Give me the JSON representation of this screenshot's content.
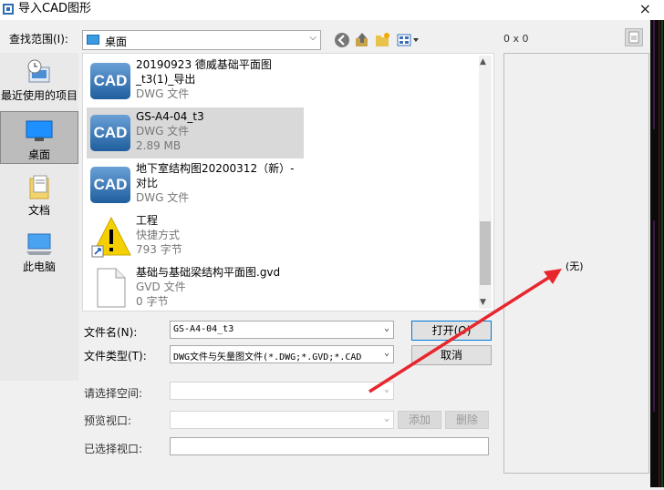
{
  "window": {
    "title": "导入CAD图形",
    "close_glyph": "×"
  },
  "lookin": {
    "label": "查找范围(I):",
    "value": "桌面"
  },
  "toolbar": {
    "back": "back-icon",
    "up": "up-folder-icon",
    "newfolder": "new-folder-icon",
    "views": "views-menu-icon"
  },
  "places": [
    {
      "label": "最近使用的项目",
      "icon": "recent-icon"
    },
    {
      "label": "桌面",
      "icon": "desktop-icon",
      "selected": true
    },
    {
      "label": "文档",
      "icon": "documents-icon"
    },
    {
      "label": "此电脑",
      "icon": "computer-icon"
    }
  ],
  "files": [
    {
      "name1": "20190923 德威基础平面图",
      "name2": "_t3(1)_导出",
      "type": "DWG 文件",
      "icon": "cad-file-icon"
    },
    {
      "name1": "GS-A4-04_t3",
      "type": "DWG 文件",
      "size": "2.89 MB",
      "icon": "cad-file-icon",
      "selected": true
    },
    {
      "name1": "地下室结构图20200312（新）-",
      "name2": "对比",
      "type": "DWG 文件",
      "icon": "cad-file-icon"
    },
    {
      "name1": "工程",
      "type": "快捷方式",
      "size": "793 字节",
      "icon": "warning-shortcut-icon"
    },
    {
      "name1": "基础与基础梁结构平面图.gvd",
      "type": "GVD 文件",
      "size": "0 字节",
      "icon": "blank-file-icon"
    }
  ],
  "cad_icon_text": "CAD",
  "form": {
    "filename_label": "文件名(N):",
    "filename_value": "GS-A4-04_t3",
    "filetype_label": "文件类型(T):",
    "filetype_value": "DWG文件与矢量图文件(*.DWG;*.GVD;*.CAD",
    "open_button": "打开(O)",
    "cancel_button": "取消",
    "space_label": "请选择空间:",
    "viewport_label": "预览视口:",
    "add_button": "添加",
    "delete_button": "删除",
    "selected_viewport_label": "已选择视口:"
  },
  "preview": {
    "size_text": "0 x 0",
    "none_text": "(无)"
  },
  "colors": {
    "selection": "#d9d9d9",
    "accent": "#0078d7",
    "annotation_arrow": "#e8262d",
    "cad_icon": "#2f6fb0"
  }
}
